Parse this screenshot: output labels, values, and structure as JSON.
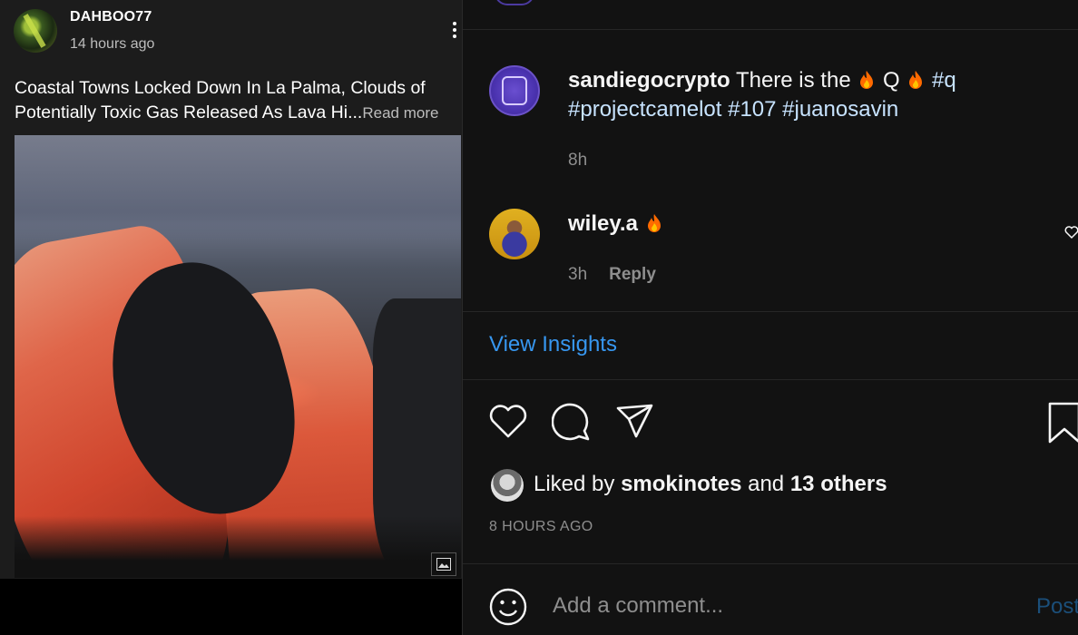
{
  "left_post": {
    "username": "DAHBOO77",
    "timestamp": "14 hours ago",
    "text": "Coastal Towns Locked Down In La Palma, Clouds of Potentially Toxic Gas Released As Lava Hi...",
    "read_more": "Read more"
  },
  "comments": [
    {
      "username": "sandiegocrypto",
      "text_before": " There is the ",
      "text_mid": " Q ",
      "hashtags": [
        "#q",
        "#projectcamelot",
        "#107",
        "#juanosavin"
      ],
      "time": "8h"
    },
    {
      "username": "wiley.a",
      "time": "3h",
      "reply_label": "Reply"
    }
  ],
  "insights_label": "View Insights",
  "likes": {
    "prefix": "Liked by ",
    "user": "smokinotes",
    "middle": " and ",
    "others": "13 others"
  },
  "posted_ago": "8 HOURS AGO",
  "comment_box": {
    "placeholder": "Add a comment...",
    "post_label": "Post"
  },
  "colors": {
    "link_blue": "#3797f0",
    "hashtag": "#c7e3ff",
    "muted": "#8e8e8e",
    "fire": "#ff6a00"
  }
}
